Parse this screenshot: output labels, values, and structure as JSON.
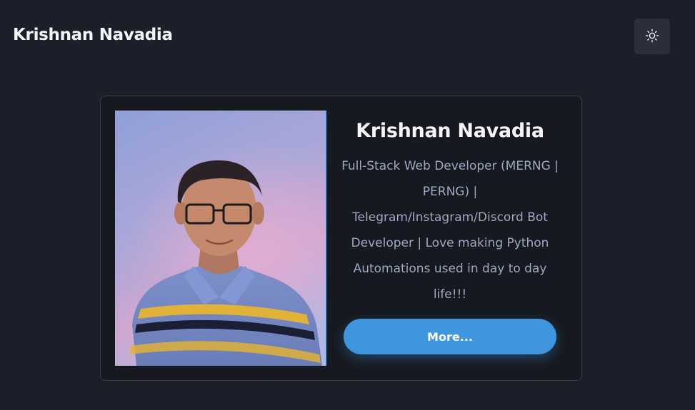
{
  "header": {
    "title": "Krishnan Navadia",
    "theme_toggle_icon": "sun-icon"
  },
  "profile": {
    "name": "Krishnan Navadia",
    "bio": "Full-Stack Web Developer (MERNG | PERNG) | Telegram/Instagram/Discord Bot Developer | Love making Python Automations used in day to day life!!!",
    "more_label": "More...",
    "photo_alt": "Krishnan Navadia"
  },
  "colors": {
    "background": "#1b1f29",
    "card": "#16191f",
    "accent": "#3f96df",
    "muted_text": "#9ea8bf"
  }
}
